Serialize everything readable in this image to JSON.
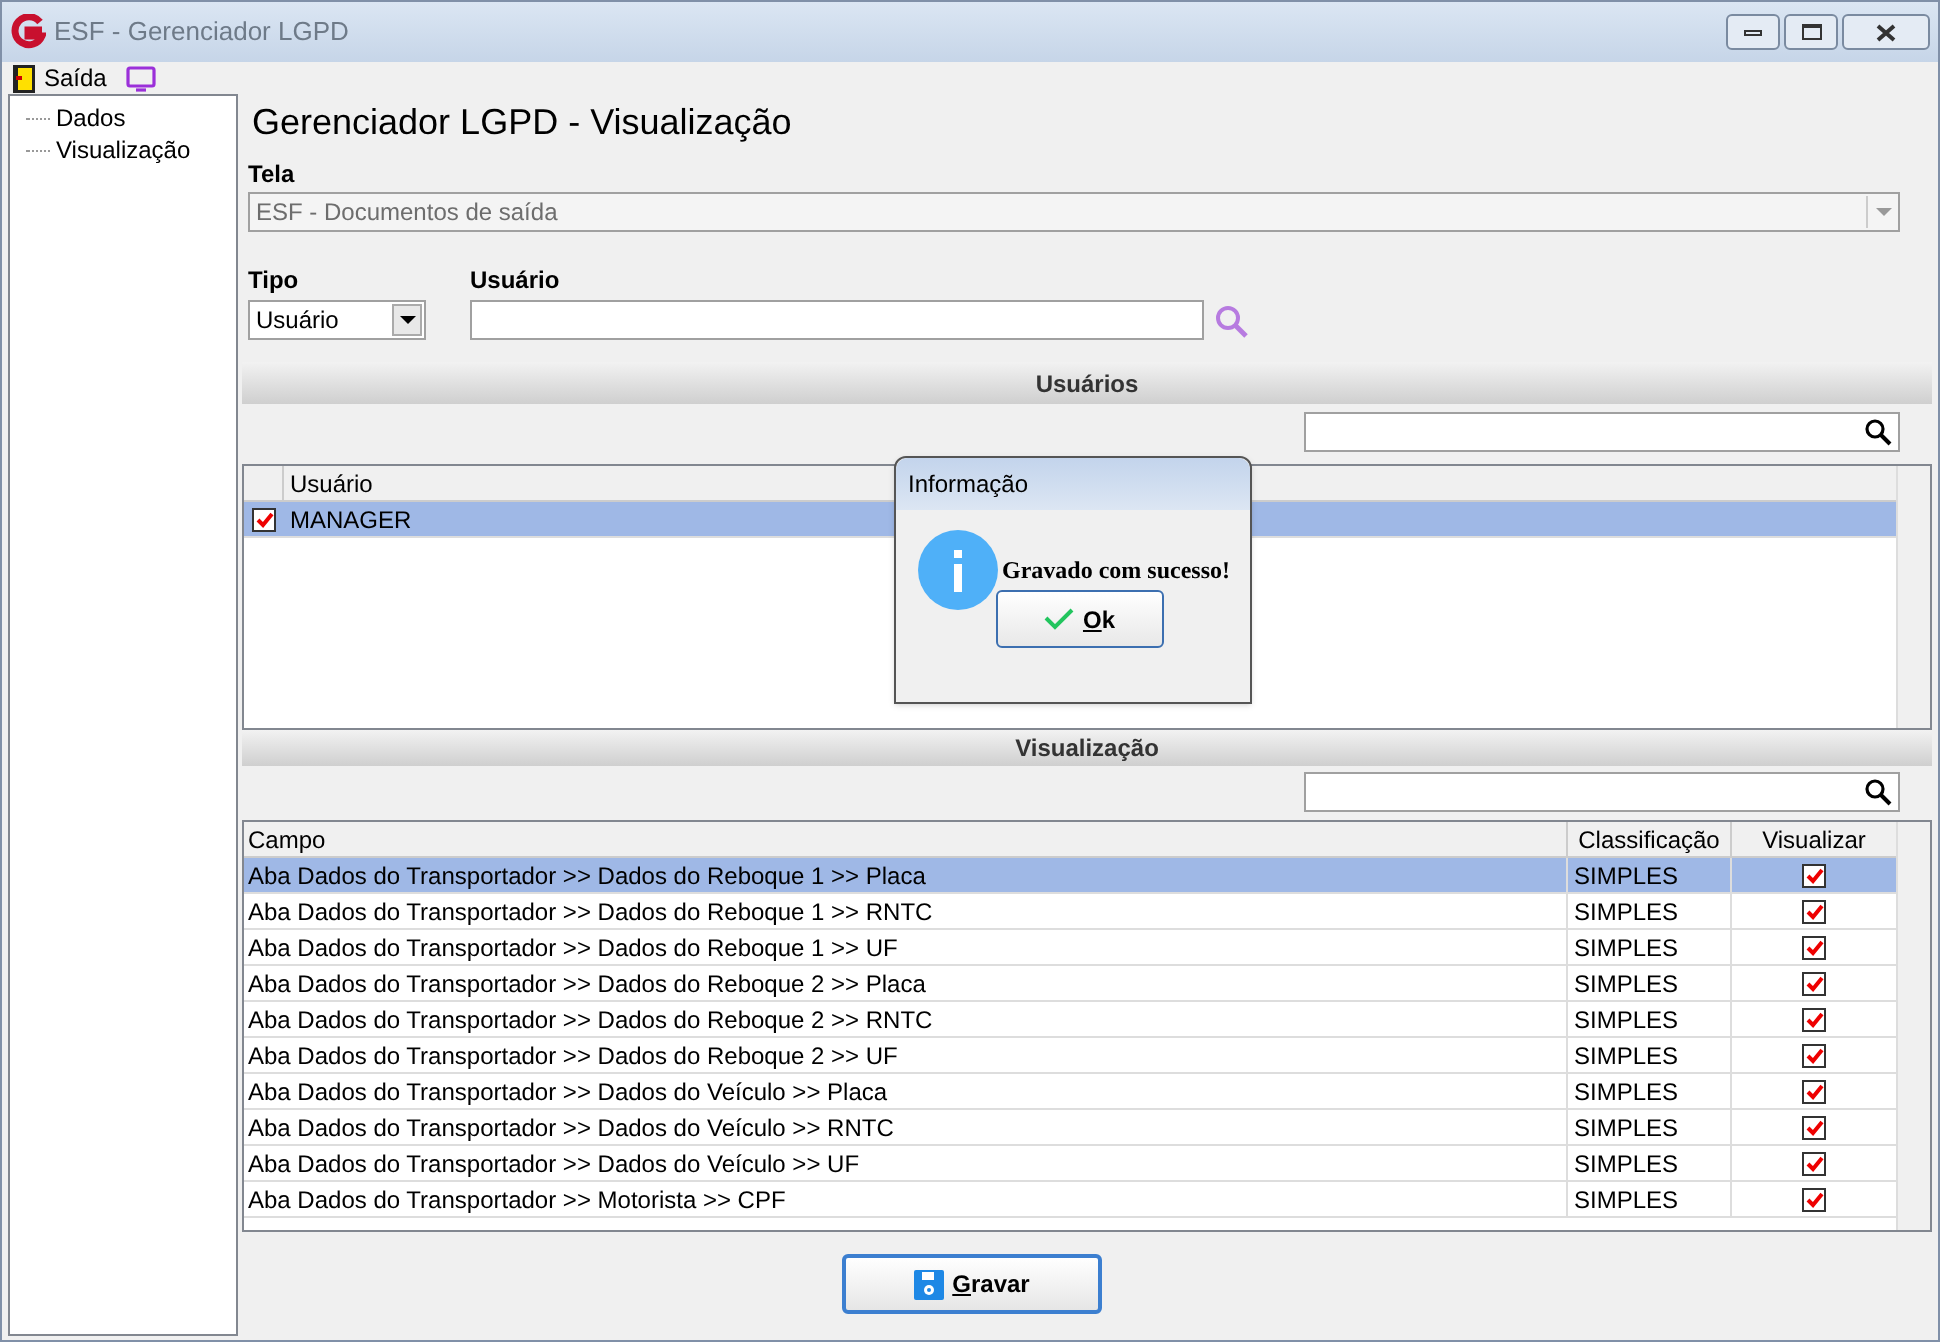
{
  "window": {
    "title": "ESF - Gerenciador LGPD"
  },
  "menu": [
    {
      "label": "Saída"
    }
  ],
  "tree": [
    {
      "label": "Dados"
    },
    {
      "label": "Visualização"
    }
  ],
  "heading": "Gerenciador LGPD - Visualização",
  "tela": {
    "label": "Tela",
    "value": "ESF - Documentos de saída"
  },
  "tipo": {
    "label": "Tipo",
    "value": "Usuário"
  },
  "usuario": {
    "label": "Usuário"
  },
  "users_section": {
    "title": "Usuários",
    "columns": [
      "Usuário"
    ],
    "rows": [
      {
        "name": "MANAGER",
        "checked": true,
        "selected": true
      }
    ]
  },
  "view_section": {
    "title": "Visualização",
    "columns": [
      "Campo",
      "Classificação",
      "Visualizar"
    ],
    "rows": [
      {
        "campo": "Aba Dados do Transportador >> Dados do Reboque 1 >> Placa",
        "classificacao": "SIMPLES",
        "visualizar": true,
        "selected": true
      },
      {
        "campo": "Aba Dados do Transportador >> Dados do Reboque 1 >> RNTC",
        "classificacao": "SIMPLES",
        "visualizar": true,
        "selected": false
      },
      {
        "campo": "Aba Dados do Transportador >> Dados do Reboque 1 >> UF",
        "classificacao": "SIMPLES",
        "visualizar": true,
        "selected": false
      },
      {
        "campo": "Aba Dados do Transportador >> Dados do Reboque 2 >> Placa",
        "classificacao": "SIMPLES",
        "visualizar": true,
        "selected": false
      },
      {
        "campo": "Aba Dados do Transportador >> Dados do Reboque 2 >> RNTC",
        "classificacao": "SIMPLES",
        "visualizar": true,
        "selected": false
      },
      {
        "campo": "Aba Dados do Transportador >> Dados do Reboque 2 >> UF",
        "classificacao": "SIMPLES",
        "visualizar": true,
        "selected": false
      },
      {
        "campo": "Aba Dados do Transportador >> Dados do Veículo >> Placa",
        "classificacao": "SIMPLES",
        "visualizar": true,
        "selected": false
      },
      {
        "campo": "Aba Dados do Transportador >> Dados do Veículo >> RNTC",
        "classificacao": "SIMPLES",
        "visualizar": true,
        "selected": false
      },
      {
        "campo": "Aba Dados do Transportador >> Dados do Veículo >> UF",
        "classificacao": "SIMPLES",
        "visualizar": true,
        "selected": false
      },
      {
        "campo": "Aba Dados do Transportador >> Motorista >> CPF",
        "classificacao": "SIMPLES",
        "visualizar": true,
        "selected": false
      }
    ]
  },
  "save_button": "Gravar",
  "dialog": {
    "title": "Informação",
    "message": "Gravado com sucesso!",
    "button": "Ok"
  }
}
